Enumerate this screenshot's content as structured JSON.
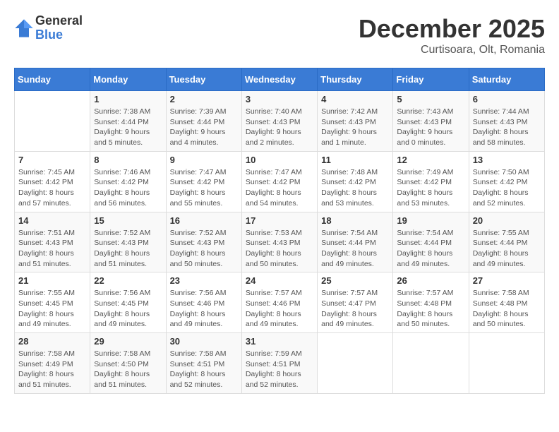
{
  "logo": {
    "general": "General",
    "blue": "Blue"
  },
  "title": "December 2025",
  "location": "Curtisoara, Olt, Romania",
  "days_of_week": [
    "Sunday",
    "Monday",
    "Tuesday",
    "Wednesday",
    "Thursday",
    "Friday",
    "Saturday"
  ],
  "weeks": [
    [
      {
        "day": "",
        "sunrise": "",
        "sunset": "",
        "daylight": ""
      },
      {
        "day": "1",
        "sunrise": "Sunrise: 7:38 AM",
        "sunset": "Sunset: 4:44 PM",
        "daylight": "Daylight: 9 hours and 5 minutes."
      },
      {
        "day": "2",
        "sunrise": "Sunrise: 7:39 AM",
        "sunset": "Sunset: 4:44 PM",
        "daylight": "Daylight: 9 hours and 4 minutes."
      },
      {
        "day": "3",
        "sunrise": "Sunrise: 7:40 AM",
        "sunset": "Sunset: 4:43 PM",
        "daylight": "Daylight: 9 hours and 2 minutes."
      },
      {
        "day": "4",
        "sunrise": "Sunrise: 7:42 AM",
        "sunset": "Sunset: 4:43 PM",
        "daylight": "Daylight: 9 hours and 1 minute."
      },
      {
        "day": "5",
        "sunrise": "Sunrise: 7:43 AM",
        "sunset": "Sunset: 4:43 PM",
        "daylight": "Daylight: 9 hours and 0 minutes."
      },
      {
        "day": "6",
        "sunrise": "Sunrise: 7:44 AM",
        "sunset": "Sunset: 4:43 PM",
        "daylight": "Daylight: 8 hours and 58 minutes."
      }
    ],
    [
      {
        "day": "7",
        "sunrise": "Sunrise: 7:45 AM",
        "sunset": "Sunset: 4:42 PM",
        "daylight": "Daylight: 8 hours and 57 minutes."
      },
      {
        "day": "8",
        "sunrise": "Sunrise: 7:46 AM",
        "sunset": "Sunset: 4:42 PM",
        "daylight": "Daylight: 8 hours and 56 minutes."
      },
      {
        "day": "9",
        "sunrise": "Sunrise: 7:47 AM",
        "sunset": "Sunset: 4:42 PM",
        "daylight": "Daylight: 8 hours and 55 minutes."
      },
      {
        "day": "10",
        "sunrise": "Sunrise: 7:47 AM",
        "sunset": "Sunset: 4:42 PM",
        "daylight": "Daylight: 8 hours and 54 minutes."
      },
      {
        "day": "11",
        "sunrise": "Sunrise: 7:48 AM",
        "sunset": "Sunset: 4:42 PM",
        "daylight": "Daylight: 8 hours and 53 minutes."
      },
      {
        "day": "12",
        "sunrise": "Sunrise: 7:49 AM",
        "sunset": "Sunset: 4:42 PM",
        "daylight": "Daylight: 8 hours and 53 minutes."
      },
      {
        "day": "13",
        "sunrise": "Sunrise: 7:50 AM",
        "sunset": "Sunset: 4:42 PM",
        "daylight": "Daylight: 8 hours and 52 minutes."
      }
    ],
    [
      {
        "day": "14",
        "sunrise": "Sunrise: 7:51 AM",
        "sunset": "Sunset: 4:43 PM",
        "daylight": "Daylight: 8 hours and 51 minutes."
      },
      {
        "day": "15",
        "sunrise": "Sunrise: 7:52 AM",
        "sunset": "Sunset: 4:43 PM",
        "daylight": "Daylight: 8 hours and 51 minutes."
      },
      {
        "day": "16",
        "sunrise": "Sunrise: 7:52 AM",
        "sunset": "Sunset: 4:43 PM",
        "daylight": "Daylight: 8 hours and 50 minutes."
      },
      {
        "day": "17",
        "sunrise": "Sunrise: 7:53 AM",
        "sunset": "Sunset: 4:43 PM",
        "daylight": "Daylight: 8 hours and 50 minutes."
      },
      {
        "day": "18",
        "sunrise": "Sunrise: 7:54 AM",
        "sunset": "Sunset: 4:44 PM",
        "daylight": "Daylight: 8 hours and 49 minutes."
      },
      {
        "day": "19",
        "sunrise": "Sunrise: 7:54 AM",
        "sunset": "Sunset: 4:44 PM",
        "daylight": "Daylight: 8 hours and 49 minutes."
      },
      {
        "day": "20",
        "sunrise": "Sunrise: 7:55 AM",
        "sunset": "Sunset: 4:44 PM",
        "daylight": "Daylight: 8 hours and 49 minutes."
      }
    ],
    [
      {
        "day": "21",
        "sunrise": "Sunrise: 7:55 AM",
        "sunset": "Sunset: 4:45 PM",
        "daylight": "Daylight: 8 hours and 49 minutes."
      },
      {
        "day": "22",
        "sunrise": "Sunrise: 7:56 AM",
        "sunset": "Sunset: 4:45 PM",
        "daylight": "Daylight: 8 hours and 49 minutes."
      },
      {
        "day": "23",
        "sunrise": "Sunrise: 7:56 AM",
        "sunset": "Sunset: 4:46 PM",
        "daylight": "Daylight: 8 hours and 49 minutes."
      },
      {
        "day": "24",
        "sunrise": "Sunrise: 7:57 AM",
        "sunset": "Sunset: 4:46 PM",
        "daylight": "Daylight: 8 hours and 49 minutes."
      },
      {
        "day": "25",
        "sunrise": "Sunrise: 7:57 AM",
        "sunset": "Sunset: 4:47 PM",
        "daylight": "Daylight: 8 hours and 49 minutes."
      },
      {
        "day": "26",
        "sunrise": "Sunrise: 7:57 AM",
        "sunset": "Sunset: 4:48 PM",
        "daylight": "Daylight: 8 hours and 50 minutes."
      },
      {
        "day": "27",
        "sunrise": "Sunrise: 7:58 AM",
        "sunset": "Sunset: 4:48 PM",
        "daylight": "Daylight: 8 hours and 50 minutes."
      }
    ],
    [
      {
        "day": "28",
        "sunrise": "Sunrise: 7:58 AM",
        "sunset": "Sunset: 4:49 PM",
        "daylight": "Daylight: 8 hours and 51 minutes."
      },
      {
        "day": "29",
        "sunrise": "Sunrise: 7:58 AM",
        "sunset": "Sunset: 4:50 PM",
        "daylight": "Daylight: 8 hours and 51 minutes."
      },
      {
        "day": "30",
        "sunrise": "Sunrise: 7:58 AM",
        "sunset": "Sunset: 4:51 PM",
        "daylight": "Daylight: 8 hours and 52 minutes."
      },
      {
        "day": "31",
        "sunrise": "Sunrise: 7:59 AM",
        "sunset": "Sunset: 4:51 PM",
        "daylight": "Daylight: 8 hours and 52 minutes."
      },
      {
        "day": "",
        "sunrise": "",
        "sunset": "",
        "daylight": ""
      },
      {
        "day": "",
        "sunrise": "",
        "sunset": "",
        "daylight": ""
      },
      {
        "day": "",
        "sunrise": "",
        "sunset": "",
        "daylight": ""
      }
    ]
  ]
}
